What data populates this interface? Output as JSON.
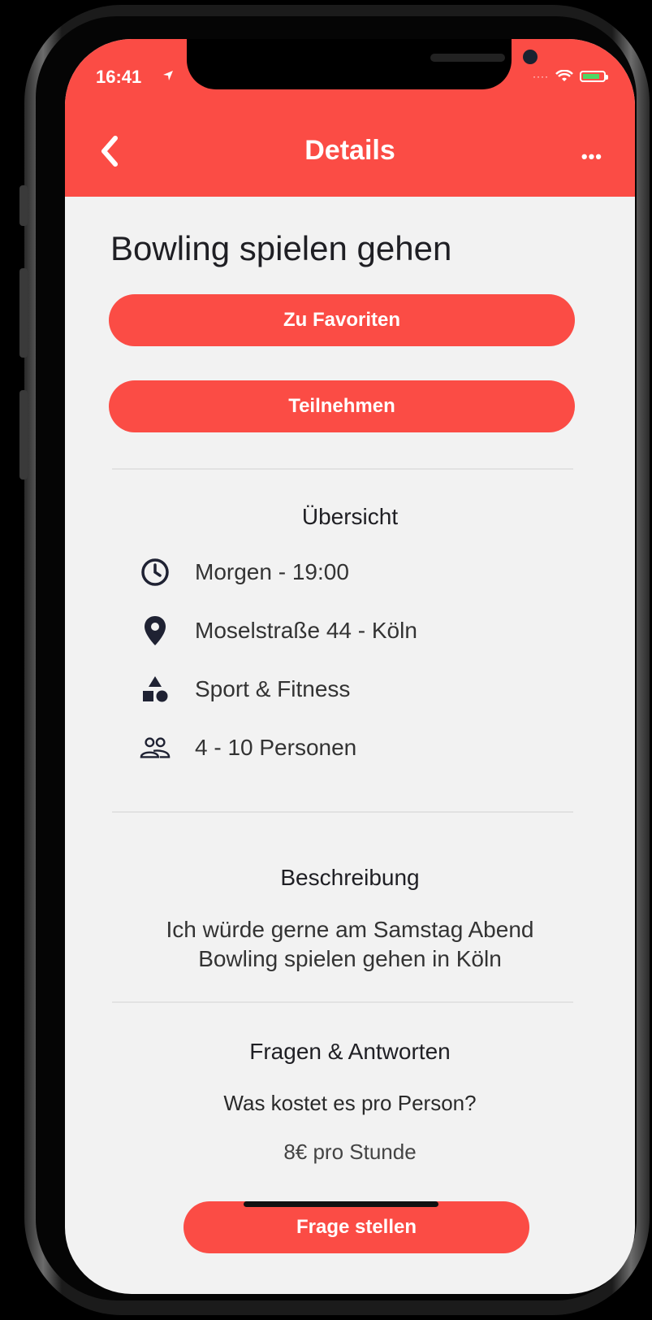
{
  "status_bar": {
    "time": "16:41"
  },
  "nav": {
    "title": "Details",
    "more_label": "•••"
  },
  "event": {
    "title": "Bowling spielen gehen"
  },
  "buttons": {
    "favorites": "Zu Favoriten",
    "join": "Teilnehmen",
    "ask": "Frage stellen"
  },
  "overview": {
    "heading": "Übersicht",
    "items": [
      {
        "icon": "clock-icon",
        "text": "Morgen - 19:00"
      },
      {
        "icon": "location-pin-icon",
        "text": "Moselstraße 44 - Köln"
      },
      {
        "icon": "shapes-icon",
        "text": "Sport & Fitness"
      },
      {
        "icon": "people-icon",
        "text": "4 - 10 Personen"
      }
    ]
  },
  "description": {
    "heading": "Beschreibung",
    "line1": "Ich würde gerne am Samstag Abend",
    "line2": "Bowling spielen gehen in Köln"
  },
  "qa": {
    "heading": "Fragen & Antworten",
    "question": "Was kostet es pro Person?",
    "answer": "8€ pro Stunde"
  },
  "colors": {
    "accent": "#fb4c45",
    "background": "#f2f2f2",
    "text": "#1f1f24"
  }
}
